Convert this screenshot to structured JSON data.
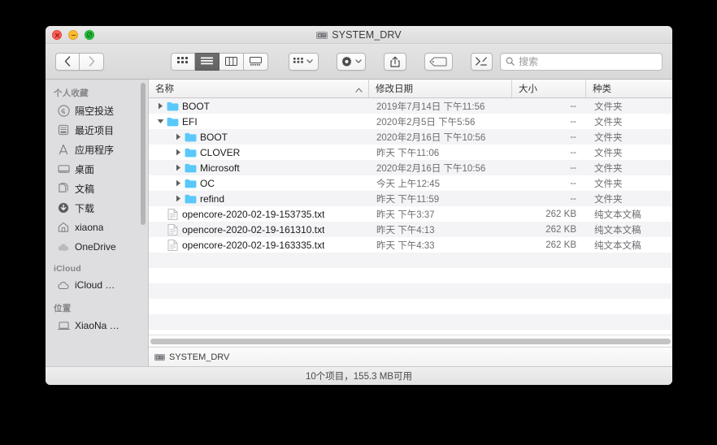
{
  "window": {
    "title": "SYSTEM_DRV",
    "title_icon": "hard-disk-icon",
    "traffic_lights": [
      {
        "name": "close",
        "color": "#ff5f57"
      },
      {
        "name": "minimize",
        "color": "#ffbd2e"
      },
      {
        "name": "maximize",
        "color": "#28c940"
      }
    ]
  },
  "toolbar": {
    "back_label": "‹",
    "forward_label": "›",
    "view_buttons": [
      {
        "name": "icon-view",
        "active": false
      },
      {
        "name": "list-view",
        "active": true
      },
      {
        "name": "column-view",
        "active": false
      },
      {
        "name": "gallery-view",
        "active": false
      }
    ],
    "group_button": "group-by-button",
    "action_button": "action-gear-button",
    "share_button": "share-button",
    "tag_button": "tag-button",
    "terminal_button": "terminal-button",
    "search": {
      "placeholder": "搜索",
      "value": ""
    }
  },
  "sidebar": {
    "groups": [
      {
        "title": "个人收藏",
        "items": [
          {
            "label": "隔空投送",
            "icon": "airdrop-icon"
          },
          {
            "label": "最近项目",
            "icon": "recents-icon"
          },
          {
            "label": "应用程序",
            "icon": "applications-icon"
          },
          {
            "label": "桌面",
            "icon": "desktop-icon"
          },
          {
            "label": "文稿",
            "icon": "documents-icon"
          },
          {
            "label": "下载",
            "icon": "downloads-icon"
          },
          {
            "label": "xiaona",
            "icon": "home-icon"
          },
          {
            "label": "OneDrive",
            "icon": "cloud-icon"
          }
        ]
      },
      {
        "title": "iCloud",
        "items": [
          {
            "label": "iCloud …",
            "icon": "icloud-icon"
          }
        ]
      },
      {
        "title": "位置",
        "items": [
          {
            "label": "XiaoNa …",
            "icon": "laptop-icon"
          }
        ]
      }
    ]
  },
  "filelist": {
    "columns": [
      {
        "key": "name",
        "label": "名称",
        "sorted": true,
        "sort_dir": "asc"
      },
      {
        "key": "date",
        "label": "修改日期"
      },
      {
        "key": "size",
        "label": "大小"
      },
      {
        "key": "kind",
        "label": "种类"
      }
    ],
    "rows": [
      {
        "name": "BOOT",
        "date": "2019年7月14日 下午11:56",
        "size": "--",
        "kind": "文件夹",
        "icon": "folder-icon",
        "depth": 0,
        "twisty": "collapsed"
      },
      {
        "name": "EFI",
        "date": "2020年2月5日 下午5:56",
        "size": "--",
        "kind": "文件夹",
        "icon": "folder-icon",
        "depth": 0,
        "twisty": "expanded"
      },
      {
        "name": "BOOT",
        "date": "2020年2月16日 下午10:56",
        "size": "--",
        "kind": "文件夹",
        "icon": "folder-icon",
        "depth": 1,
        "twisty": "collapsed"
      },
      {
        "name": "CLOVER",
        "date": "昨天 下午11:06",
        "size": "--",
        "kind": "文件夹",
        "icon": "folder-icon",
        "depth": 1,
        "twisty": "collapsed"
      },
      {
        "name": "Microsoft",
        "date": "2020年2月16日 下午10:56",
        "size": "--",
        "kind": "文件夹",
        "icon": "folder-icon",
        "depth": 1,
        "twisty": "collapsed"
      },
      {
        "name": "OC",
        "date": "今天 上午12:45",
        "size": "--",
        "kind": "文件夹",
        "icon": "folder-icon",
        "depth": 1,
        "twisty": "collapsed"
      },
      {
        "name": "refind",
        "date": "昨天 下午11:59",
        "size": "--",
        "kind": "文件夹",
        "icon": "folder-icon",
        "depth": 1,
        "twisty": "collapsed"
      },
      {
        "name": "opencore-2020-02-19-153735.txt",
        "date": "昨天 下午3:37",
        "size": "262 KB",
        "kind": "纯文本文稿",
        "icon": "text-file-icon",
        "depth": 0,
        "twisty": "none"
      },
      {
        "name": "opencore-2020-02-19-161310.txt",
        "date": "昨天 下午4:13",
        "size": "262 KB",
        "kind": "纯文本文稿",
        "icon": "text-file-icon",
        "depth": 0,
        "twisty": "none"
      },
      {
        "name": "opencore-2020-02-19-163335.txt",
        "date": "昨天 下午4:33",
        "size": "262 KB",
        "kind": "纯文本文稿",
        "icon": "text-file-icon",
        "depth": 0,
        "twisty": "none"
      }
    ]
  },
  "pathbar": {
    "icon": "hard-disk-icon",
    "label": "SYSTEM_DRV"
  },
  "statusbar": {
    "text": "10个项目，155.3 MB可用"
  },
  "colors": {
    "folder_blue": "#5ac8fa",
    "selected_view_bg": "#6e6e6e",
    "window_bg": "#ececec",
    "sidebar_bg": "#dedee0"
  }
}
